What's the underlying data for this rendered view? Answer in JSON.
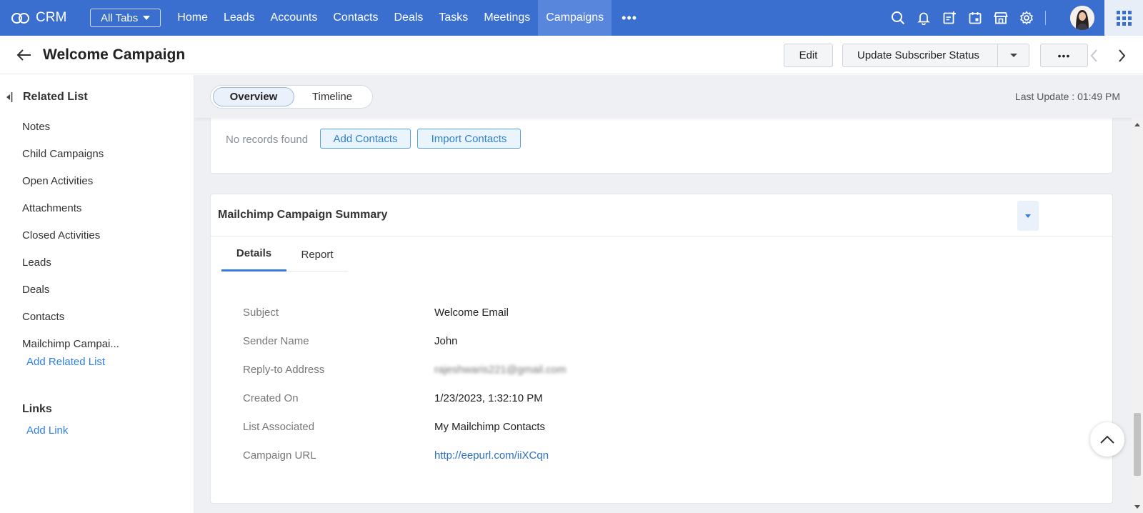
{
  "app": {
    "brand": "CRM",
    "all_tabs_label": "All Tabs",
    "nav_tabs": [
      "Home",
      "Leads",
      "Accounts",
      "Contacts",
      "Deals",
      "Tasks",
      "Meetings",
      "Campaigns"
    ],
    "active_tab": "Campaigns",
    "nav_more": "•••",
    "icons": [
      "search-icon",
      "bell-icon",
      "add-note-icon",
      "calendar-icon",
      "marketplace-icon",
      "gear-icon",
      "avatar",
      "app-grid-icon"
    ],
    "accent_color": "#3a6fd0"
  },
  "header": {
    "title": "Welcome Campaign",
    "edit_label": "Edit",
    "update_label": "Update Subscriber Status",
    "more_label": "•••"
  },
  "sidebar": {
    "related_title": "Related List",
    "items": [
      "Notes",
      "Child Campaigns",
      "Open Activities",
      "Attachments",
      "Closed Activities",
      "Leads",
      "Deals",
      "Contacts",
      "Mailchimp Campai..."
    ],
    "add_related": "Add Related List",
    "links_title": "Links",
    "add_link": "Add Link"
  },
  "view": {
    "tabs": [
      "Overview",
      "Timeline"
    ],
    "active": "Overview",
    "last_update": "Last Update : 01:49 PM"
  },
  "contacts_card": {
    "empty_text": "No records found",
    "add_label": "Add Contacts",
    "import_label": "Import Contacts"
  },
  "summary": {
    "title": "Mailchimp Campaign Summary",
    "tabs": [
      "Details",
      "Report"
    ],
    "active_tab": "Details",
    "rows": [
      {
        "label": "Subject",
        "value": "Welcome Email"
      },
      {
        "label": "Sender Name",
        "value": "John"
      },
      {
        "label": "Reply-to Address",
        "value": "rajeshwaris221@gmail.com"
      },
      {
        "label": "Created On",
        "value": "1/23/2023, 1:32:10 PM"
      },
      {
        "label": "List Associated",
        "value": "My Mailchimp Contacts"
      },
      {
        "label": "Campaign URL",
        "value": "http://eepurl.com/iiXCqn"
      }
    ]
  }
}
